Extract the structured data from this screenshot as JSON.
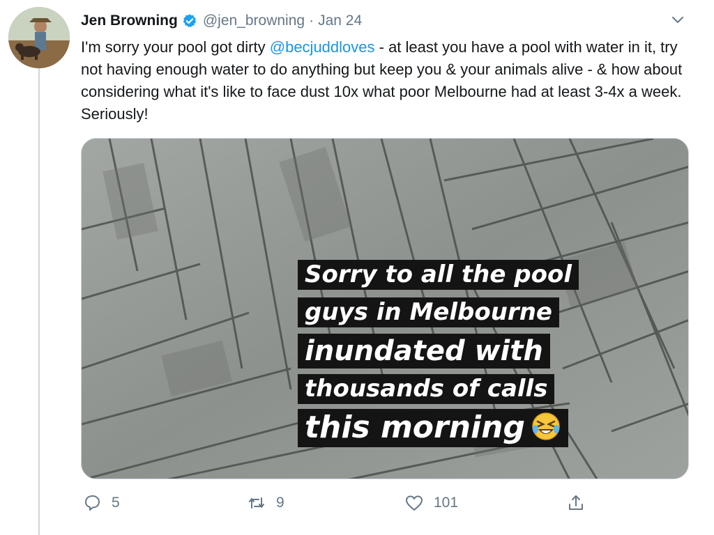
{
  "tweet": {
    "author_name": "Jen Browning",
    "handle": "@jen_browning",
    "separator": "·",
    "date": "Jan 24",
    "text_before": "I'm sorry your pool got dirty ",
    "mention": "@becjuddloves",
    "text_after": " - at least you have a pool with water in it, try not having enough water to do anything but keep you & your animals alive - & how about considering what it's like to face dust 10x what poor Melbourne had at least 3-4x a week. Seriously!"
  },
  "media": {
    "caption_lines": [
      "Sorry to all the pool",
      "guys in Melbourne",
      "inundated with",
      "thousands of calls",
      "this morning"
    ],
    "emoji": "rolling-on-floor-laughing"
  },
  "actions": {
    "reply_count": "5",
    "retweet_count": "9",
    "like_count": "101"
  },
  "colors": {
    "link": "#1b95e0",
    "muted": "#657786",
    "verified": "#1da1f2",
    "caption_bg": "#141414"
  },
  "icons": [
    "verified-badge-icon",
    "chevron-down-icon",
    "reply-icon",
    "retweet-icon",
    "like-icon",
    "share-icon",
    "laughing-emoji-icon"
  ]
}
